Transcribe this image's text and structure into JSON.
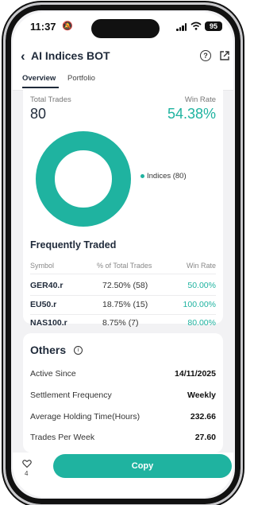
{
  "status_bar": {
    "time": "11:37",
    "battery": "95"
  },
  "header": {
    "title": "AI Indices BOT",
    "tabs": [
      {
        "label": "Overview",
        "active": true
      },
      {
        "label": "Portfolio",
        "active": false
      }
    ]
  },
  "summary": {
    "total_trades_label": "Total Trades",
    "total_trades_value": "80",
    "win_rate_label": "Win Rate",
    "win_rate_value": "54.38%"
  },
  "donut": {
    "legend_label": "Indices (80)",
    "color": "#1fb3a0",
    "share": 1.0
  },
  "frequently_traded": {
    "title": "Frequently Traded",
    "columns": [
      "Symbol",
      "% of Total Trades",
      "Win Rate"
    ],
    "rows": [
      {
        "symbol": "GER40.r",
        "pct": "72.50% (58)",
        "win_rate": "50.00%"
      },
      {
        "symbol": "EU50.r",
        "pct": "18.75% (15)",
        "win_rate": "100.00%"
      },
      {
        "symbol": "NAS100.r",
        "pct": "8.75% (7)",
        "win_rate": "80.00%"
      }
    ]
  },
  "others": {
    "title": "Others",
    "rows": [
      {
        "label": "Active Since",
        "value": "14/11/2025"
      },
      {
        "label": "Settlement Frequency",
        "value": "Weekly"
      },
      {
        "label": "Average Holding Time(Hours)",
        "value": "232.66"
      },
      {
        "label": "Trades Per Week",
        "value": "27.60"
      }
    ]
  },
  "bottom": {
    "like_count": "4",
    "copy_label": "Copy"
  },
  "colors": {
    "accent": "#1fb3a0",
    "text_dark": "#1f2a3a"
  }
}
